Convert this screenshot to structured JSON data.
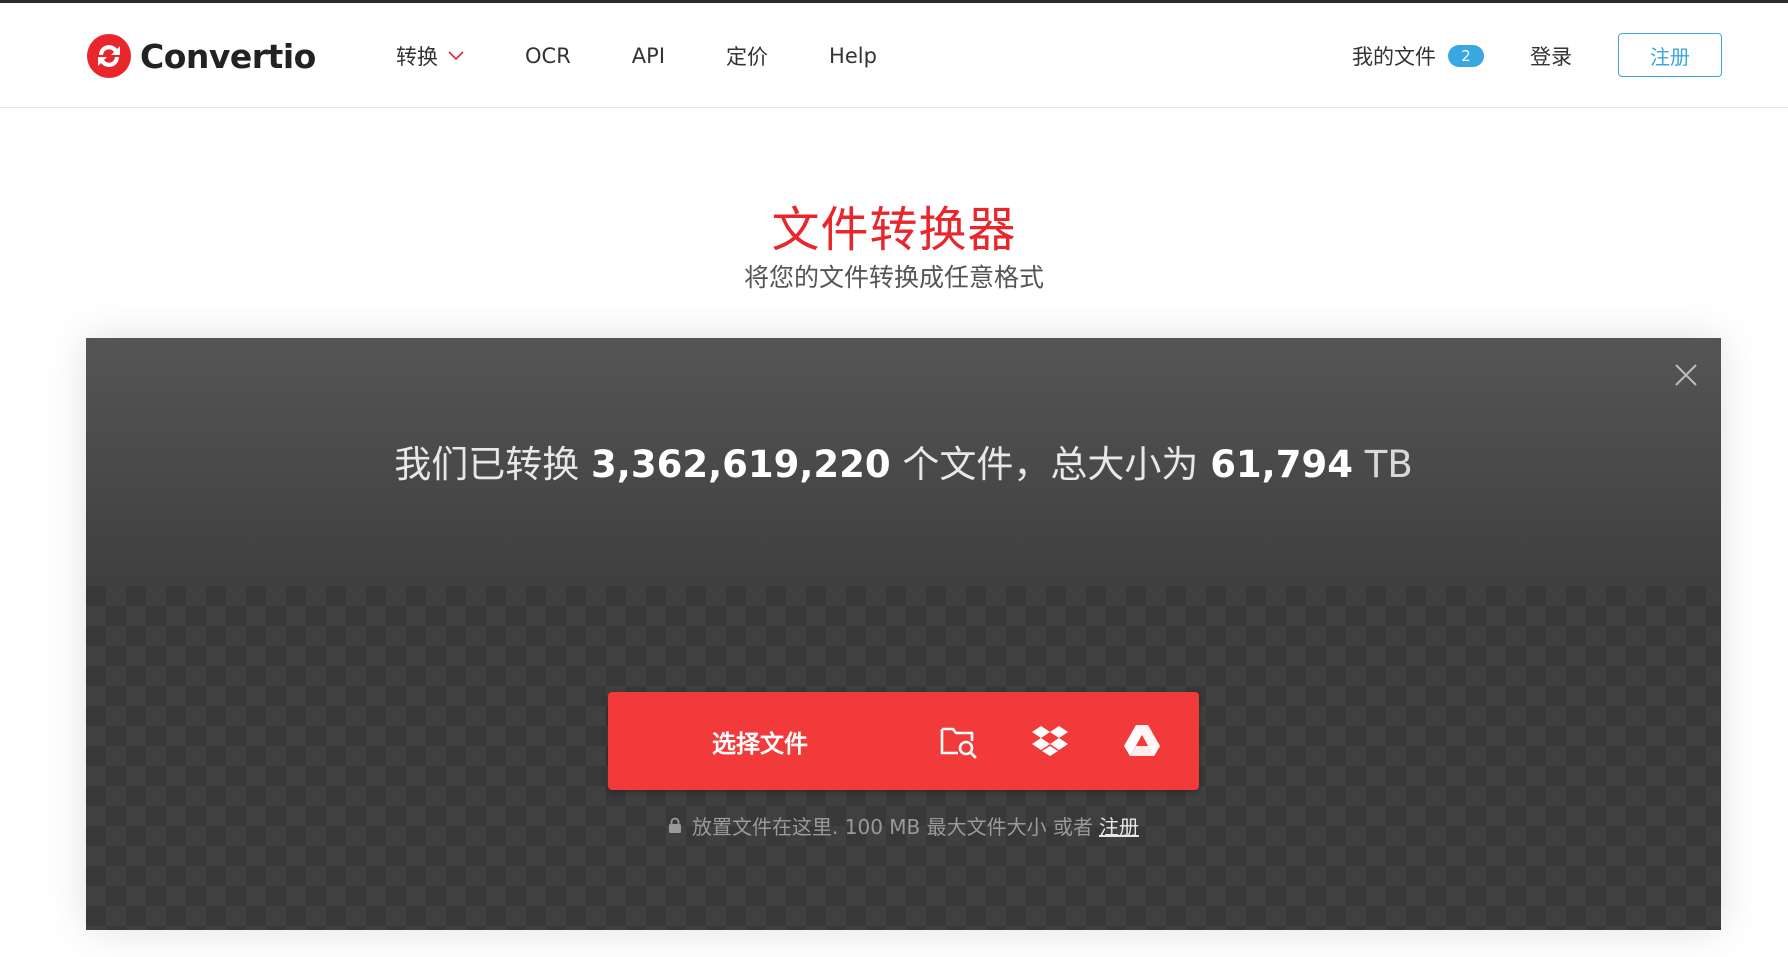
{
  "brand": {
    "name": "Convertio",
    "logo_colors": [
      "#e8262b"
    ]
  },
  "nav": {
    "items": [
      {
        "label": "转换",
        "has_dropdown": true
      },
      {
        "label": "OCR"
      },
      {
        "label": "API"
      },
      {
        "label": "定价"
      },
      {
        "label": "Help"
      }
    ]
  },
  "header_right": {
    "my_files_label": "我的文件",
    "my_files_count": "2",
    "login_label": "登录",
    "signup_label": "注册"
  },
  "hero": {
    "title": "文件转换器",
    "subtitle": "将您的文件转换成任意格式"
  },
  "stats": {
    "prefix": "我们已转换",
    "files_count": "3,362,619,220",
    "middle": "个文件，总大小为",
    "total_size": "61,794",
    "unit": "TB"
  },
  "upload": {
    "choose_label": "选择文件",
    "sources": [
      "folder-search-icon",
      "dropbox-icon",
      "google-drive-icon"
    ],
    "hint_text": "放置文件在这里. 100 MB 最大文件大小 或者",
    "hint_link": "注册"
  },
  "colors": {
    "accent_red": "#f33a3a",
    "link_blue": "#3aa7e0",
    "title_red": "#e8262b"
  }
}
